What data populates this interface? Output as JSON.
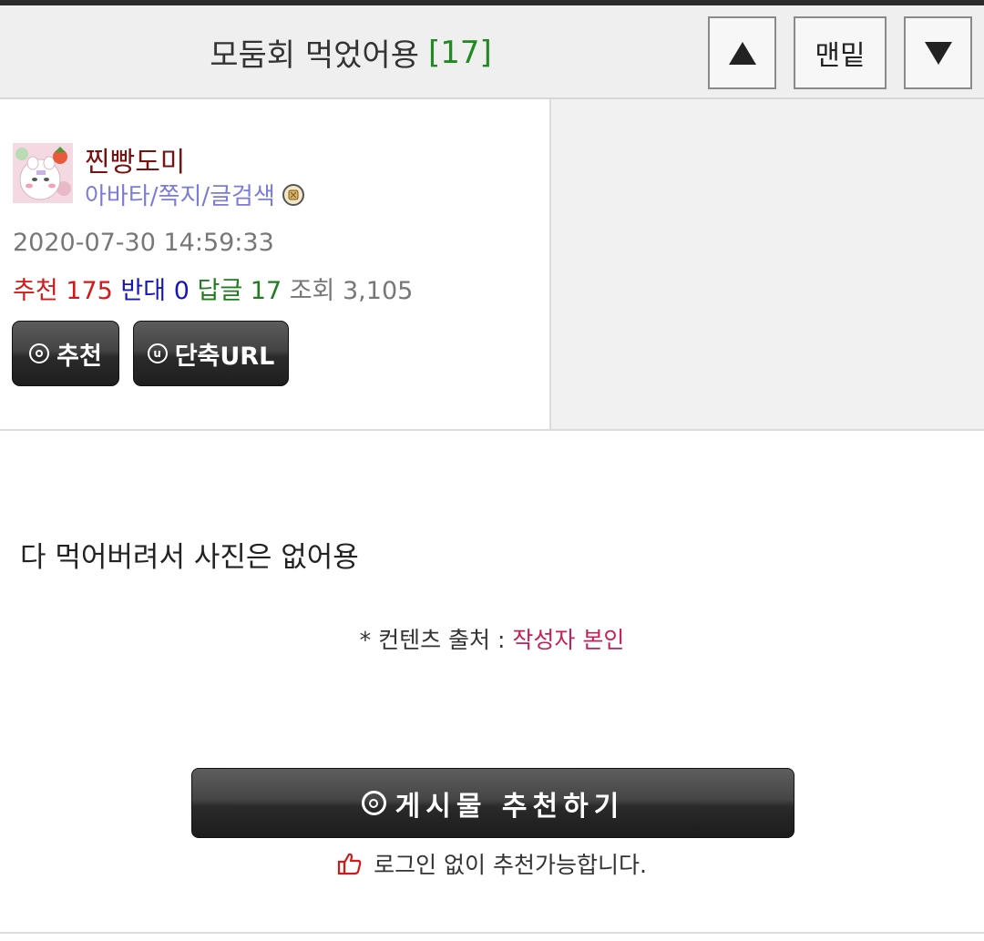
{
  "header": {
    "title": "모둠회 먹었어용",
    "count": "[17]",
    "bottom_label": "맨밑"
  },
  "author": {
    "nickname": "찐빵도미",
    "links": "아바타/쪽지/글검색",
    "date": "2020-07-30 14:59:33",
    "stats": {
      "recommend_label": "추천",
      "recommend_value": "175",
      "oppose_label": "반대",
      "oppose_value": "0",
      "reply_label": "답글",
      "reply_value": "17",
      "view_label": "조회",
      "view_value": "3,105"
    },
    "recommend_button": "추천",
    "short_url_button": "단축URL"
  },
  "post": {
    "body": "다 먹어버려서 사진은 없어용",
    "source_label": "* 컨텐츠 출처 :",
    "source_value": "작성자 본인",
    "recommend_big": "게시물 추천하기",
    "notice": "로그인 없이 추천가능합니다."
  },
  "colors": {
    "nickname": "#7a1010",
    "recommend": "#d21a1a",
    "oppose": "#1616b5",
    "reply": "#1f7d1f",
    "source_value": "#c41f57"
  },
  "icons": [
    "arrow-up-icon",
    "arrow-down-icon",
    "badge-icon",
    "recommend-circle-icon",
    "url-circle-icon",
    "thumbs-up-icon"
  ]
}
